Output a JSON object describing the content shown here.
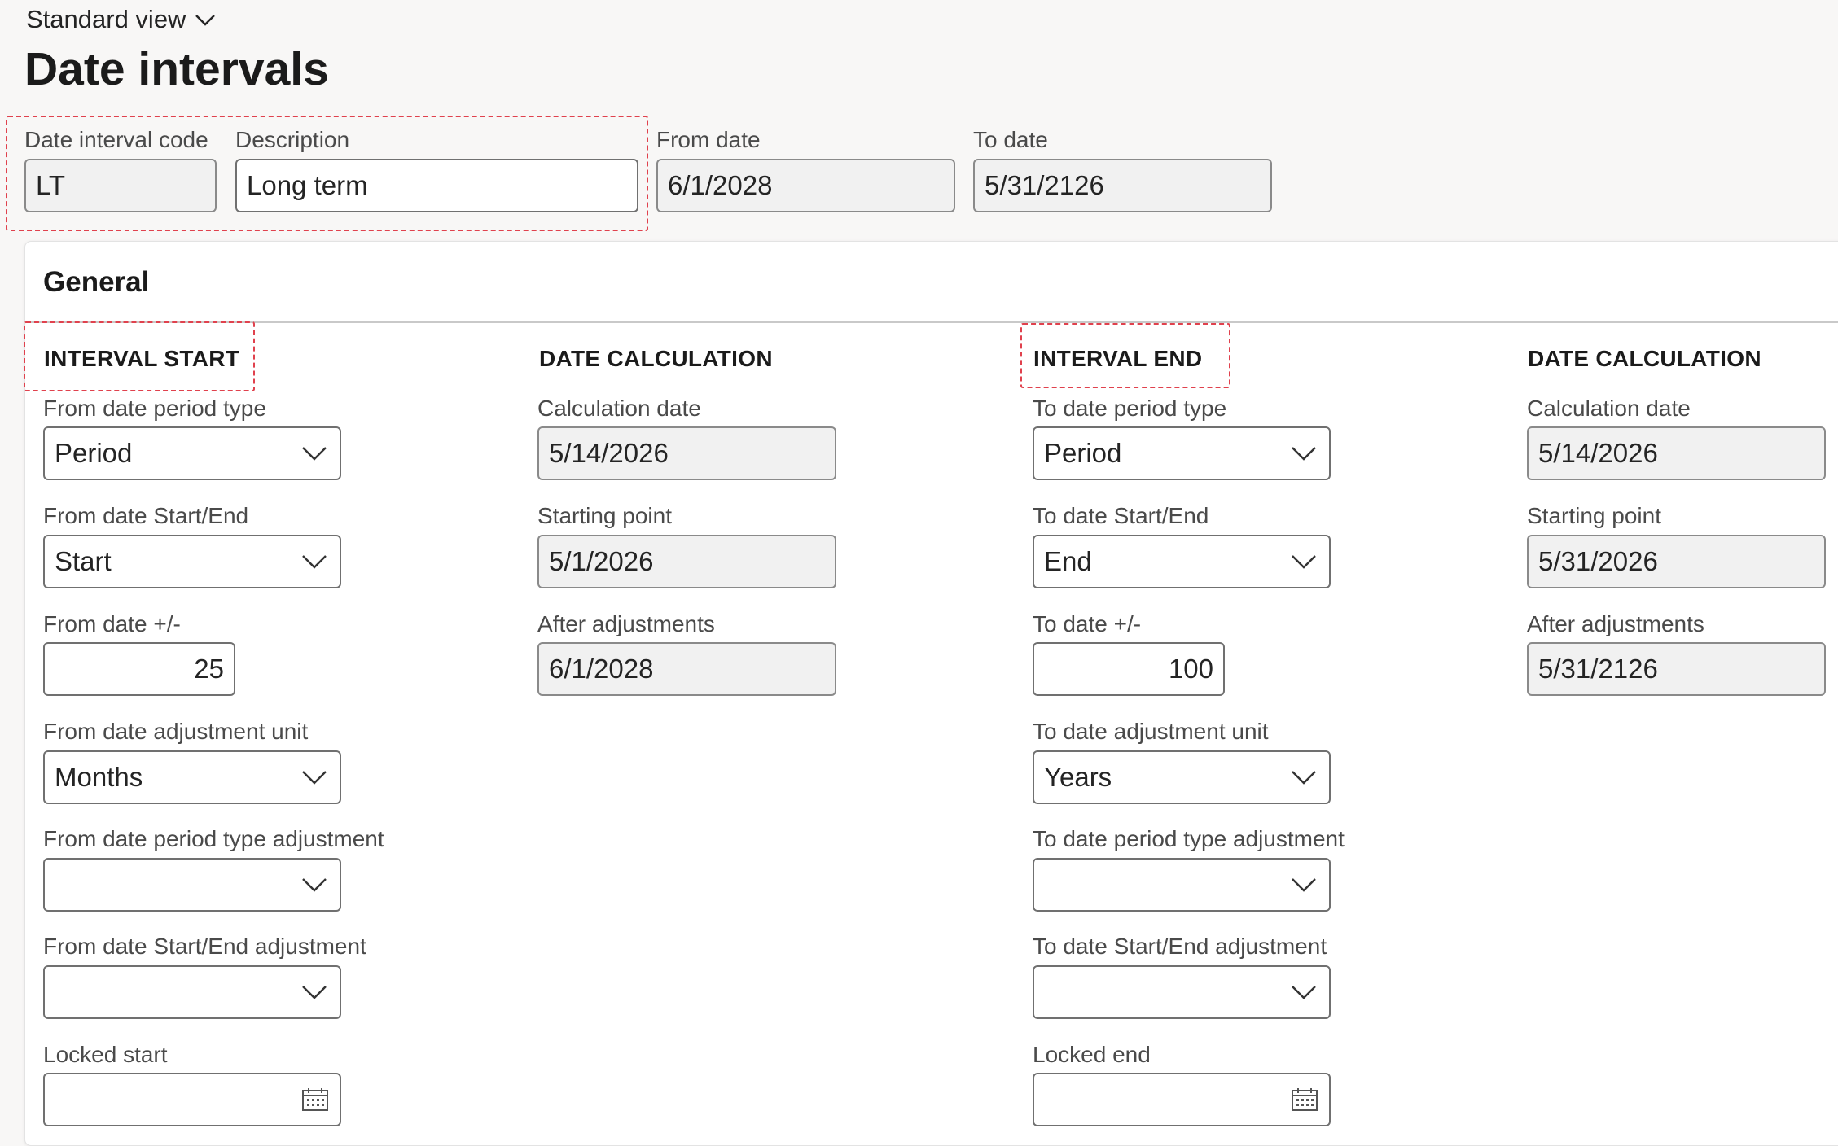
{
  "header": {
    "view_selector": "Standard view",
    "page_title": "Date intervals"
  },
  "top_fields": {
    "code_label": "Date interval code",
    "code_value": "LT",
    "description_label": "Description",
    "description_value": "Long term",
    "from_date_label": "From date",
    "from_date_value": "6/1/2028",
    "to_date_label": "To date",
    "to_date_value": "5/31/2126"
  },
  "general": {
    "title": "General",
    "interval_start": {
      "heading": "INTERVAL START",
      "period_type_label": "From date period type",
      "period_type_value": "Period",
      "start_end_label": "From date Start/End",
      "start_end_value": "Start",
      "plus_minus_label": "From date +/-",
      "plus_minus_value": "25",
      "adjustment_unit_label": "From date adjustment unit",
      "adjustment_unit_value": "Months",
      "period_type_adj_label": "From date period type adjustment",
      "period_type_adj_value": "",
      "start_end_adj_label": "From date Start/End adjustment",
      "start_end_adj_value": "",
      "locked_label": "Locked start",
      "locked_value": ""
    },
    "start_calc": {
      "heading": "DATE CALCULATION",
      "calc_date_label": "Calculation date",
      "calc_date_value": "5/14/2026",
      "starting_point_label": "Starting point",
      "starting_point_value": "5/1/2026",
      "after_adj_label": "After adjustments",
      "after_adj_value": "6/1/2028"
    },
    "interval_end": {
      "heading": "INTERVAL END",
      "period_type_label": "To date period type",
      "period_type_value": "Period",
      "start_end_label": "To date Start/End",
      "start_end_value": "End",
      "plus_minus_label": "To date +/-",
      "plus_minus_value": "100",
      "adjustment_unit_label": "To date adjustment unit",
      "adjustment_unit_value": "Years",
      "period_type_adj_label": "To date period type adjustment",
      "period_type_adj_value": "",
      "start_end_adj_label": "To date Start/End adjustment",
      "start_end_adj_value": "",
      "locked_label": "Locked end",
      "locked_value": ""
    },
    "end_calc": {
      "heading": "DATE CALCULATION",
      "calc_date_label": "Calculation date",
      "calc_date_value": "5/14/2026",
      "starting_point_label": "Starting point",
      "starting_point_value": "5/31/2026",
      "after_adj_label": "After adjustments",
      "after_adj_value": "5/31/2126"
    }
  },
  "icons": {
    "dropdown": "chevron-down-icon",
    "calendar": "calendar-icon"
  },
  "colors": {
    "highlight_box": "#e0414d",
    "readonly_bg": "#f1f1f1",
    "page_bg": "#f8f7f6"
  }
}
